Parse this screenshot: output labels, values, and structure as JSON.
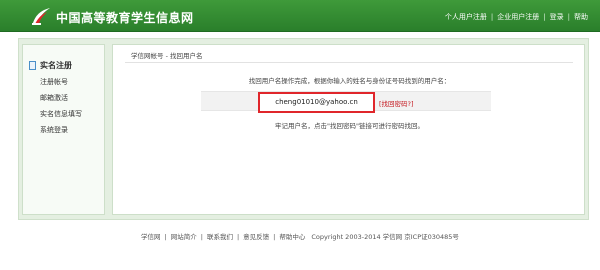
{
  "header": {
    "site_title": "中国高等教育学生信息网",
    "nav": [
      "个人用户注册",
      "企业用户注册",
      "登录",
      "帮助"
    ]
  },
  "sidebar": {
    "title": "实名注册",
    "items": [
      "注册帐号",
      "邮箱激活",
      "实名信息填写",
      "系统登录"
    ]
  },
  "main": {
    "breadcrumb": "学信网帐号 - 找回用户名",
    "done_text": "找回用户名操作完成，根据你输入的姓名与身份证号码找到的用户名：",
    "username": "cheng01010@yahoo.cn",
    "retrieve_password_link": "[找回密码?]",
    "note_text": "牢记用户名，点击\"找回密码\"链接可进行密码找回。"
  },
  "footer": {
    "links": [
      "学信网",
      "网站简介",
      "联系我们",
      "意见反馈",
      "帮助中心"
    ],
    "copyright": "Copyright 2003-2014 学信网 京ICP证030485号"
  },
  "colors": {
    "header_green": "#2f8a2f",
    "highlight_red": "#e0262b",
    "link_red": "#c4151c"
  }
}
